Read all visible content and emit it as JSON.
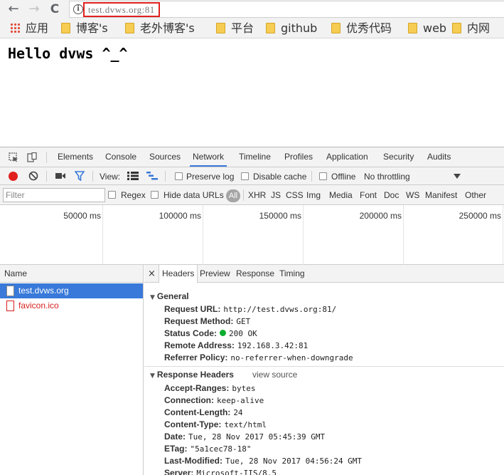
{
  "browser": {
    "url": "test.dvws.org:81",
    "nav_back": "←",
    "nav_forward": "→",
    "nav_reload": "C",
    "info_glyph": "i"
  },
  "bookmarks": [
    {
      "label": "应用",
      "icon": "apps-grid-icon"
    },
    {
      "label": "博客's",
      "icon": "folder-icon"
    },
    {
      "label": "老外博客's",
      "icon": "folder-icon"
    },
    {
      "label": "平台",
      "icon": "folder-icon"
    },
    {
      "label": "github",
      "icon": "folder-icon"
    },
    {
      "label": "优秀代码",
      "icon": "folder-icon"
    },
    {
      "label": "web",
      "icon": "folder-icon"
    },
    {
      "label": "内网",
      "icon": "folder-icon"
    }
  ],
  "page": {
    "heading": "Hello dvws ^_^"
  },
  "devtools": {
    "tabs": [
      "Elements",
      "Console",
      "Sources",
      "Network",
      "Timeline",
      "Profiles",
      "Application",
      "Security",
      "Audits"
    ],
    "active_tab": "Network",
    "toolbar": {
      "view_label": "View:",
      "preserve_log": "Preserve log",
      "disable_cache": "Disable cache",
      "offline": "Offline",
      "throttling": "No throttling"
    },
    "filter": {
      "placeholder": "Filter",
      "regex": "Regex",
      "hide_data_urls": "Hide data URLs",
      "all": "All",
      "types": [
        "XHR",
        "JS",
        "CSS",
        "Img",
        "Media",
        "Font",
        "Doc",
        "WS",
        "Manifest",
        "Other"
      ]
    },
    "overview_ticks": [
      "50000 ms",
      "100000 ms",
      "150000 ms",
      "200000 ms",
      "250000 ms"
    ],
    "requests": {
      "column": "Name",
      "items": [
        {
          "name": "test.dvws.org",
          "state": "selected"
        },
        {
          "name": "favicon.ico",
          "state": "error"
        }
      ]
    },
    "details": {
      "close": "×",
      "tabs": [
        "Headers",
        "Preview",
        "Response",
        "Timing"
      ],
      "active_tab": "Headers",
      "general": {
        "title": "General",
        "rows": [
          {
            "key": "Request URL:",
            "value": "http://test.dvws.org:81/"
          },
          {
            "key": "Request Method:",
            "value": "GET"
          },
          {
            "key": "Status Code:",
            "value": "200 OK"
          },
          {
            "key": "Remote Address:",
            "value": "192.168.3.42:81"
          },
          {
            "key": "Referrer Policy:",
            "value": "no-referrer-when-downgrade"
          }
        ]
      },
      "response_headers": {
        "title": "Response Headers",
        "view_source": "view source",
        "rows": [
          {
            "key": "Accept-Ranges:",
            "value": "bytes"
          },
          {
            "key": "Connection:",
            "value": "keep-alive"
          },
          {
            "key": "Content-Length:",
            "value": "24"
          },
          {
            "key": "Content-Type:",
            "value": "text/html"
          },
          {
            "key": "Date:",
            "value": "Tue, 28 Nov 2017 05:45:39 GMT"
          },
          {
            "key": "ETag:",
            "value": "\"5a1cec78-18\""
          },
          {
            "key": "Last-Modified:",
            "value": "Tue, 28 Nov 2017 04:56:24 GMT"
          },
          {
            "key": "Server:",
            "value": "Microsoft-IIS/8.5"
          }
        ]
      }
    }
  },
  "colors": {
    "accent_blue": "#3879d9",
    "record_red": "#e0201f",
    "status_green": "#0aad2f",
    "error_red": "#d81f1f",
    "url_highlight": "#e02020"
  }
}
